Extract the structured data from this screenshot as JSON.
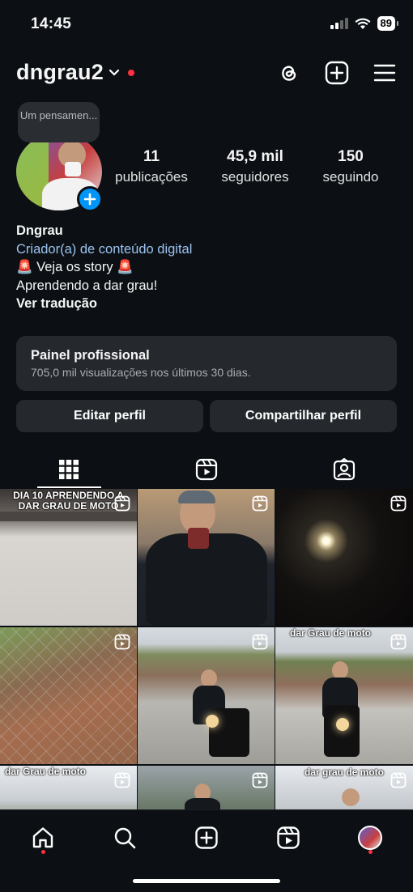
{
  "status_bar": {
    "time": "14:45",
    "battery": "89"
  },
  "header": {
    "username": "dngrau2"
  },
  "profile": {
    "note": "Um pensamen...",
    "stats": [
      {
        "value": "11",
        "label": "publicações"
      },
      {
        "value": "45,9 mil",
        "label": "seguidores"
      },
      {
        "value": "150",
        "label": "seguindo"
      }
    ],
    "bio": {
      "name": "Dngrau",
      "category": "Criador(a) de conteúdo digital",
      "line1": "🚨 Veja os story 🚨",
      "line2": "Aprendendo a dar grau!",
      "translate": "Ver tradução"
    }
  },
  "panel": {
    "title": "Painel profissional",
    "subtitle": "705,0 mil visualizações nos últimos 30 dias."
  },
  "buttons": {
    "edit": "Editar perfil",
    "share": "Compartilhar perfil"
  },
  "grid": {
    "captions": [
      "DIA 10 APRENDENDO A DAR GRAU DE MOTO",
      "dar Grau de moto",
      "dar Grau de moto",
      "dar grau de moto"
    ]
  },
  "icons": {
    "threads": "threads-icon",
    "create": "plus-square-icon",
    "menu": "hamburger-menu-icon",
    "grid": "grid-icon",
    "reels": "reels-icon",
    "tagged": "tagged-icon",
    "home": "home-icon",
    "search": "search-icon",
    "new_post": "new-post-icon",
    "reels_nav": "reels-nav-icon",
    "profile": "profile-avatar-icon"
  },
  "colors": {
    "accent": "#0095f6",
    "background": "#0c1014",
    "notification": "#ff3040",
    "link": "#9bc3f0"
  }
}
